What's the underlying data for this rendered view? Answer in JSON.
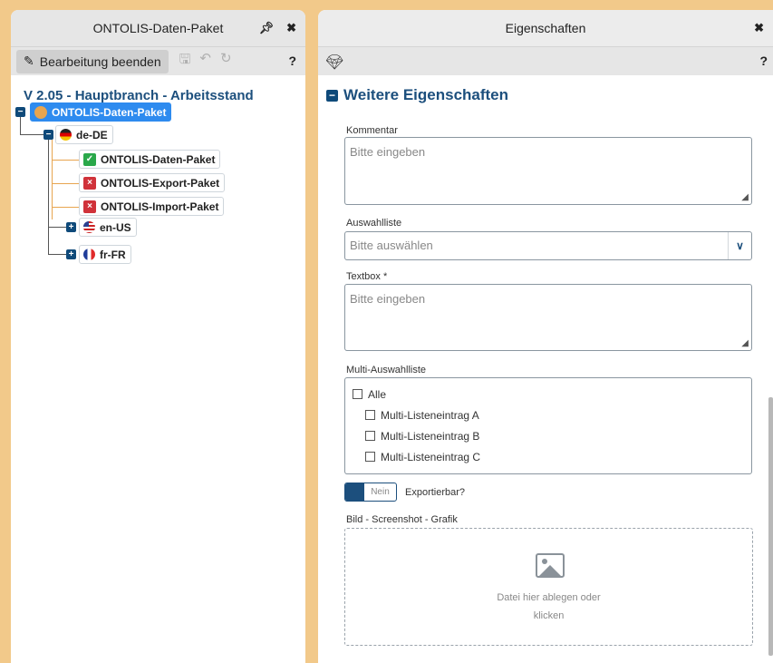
{
  "left_panel": {
    "title": "ONTOLIS-Daten-Paket",
    "pin_icon": "pin-icon",
    "close_icon": "close-icon",
    "edit_button_label": "Bearbeitung beenden",
    "help_label": "?",
    "version_line": "V 2.05 - Hauptbranch - Arbeitsstand",
    "tree": {
      "root": "ONTOLIS-Daten-Paket",
      "lang_de": "de-DE",
      "children": [
        {
          "label": "ONTOLIS-Daten-Paket",
          "status": "ok"
        },
        {
          "label": "ONTOLIS-Export-Paket",
          "status": "error"
        },
        {
          "label": "ONTOLIS-Import-Paket",
          "status": "error"
        }
      ],
      "lang_us": "en-US",
      "lang_fr": "fr-FR"
    }
  },
  "right_panel": {
    "title": "Eigenschaften",
    "help_label": "?",
    "section_title": "Weitere Eigenschaften",
    "fields": {
      "comment_label": "Kommentar",
      "comment_placeholder": "Bitte eingeben",
      "select_label": "Auswahlliste",
      "select_placeholder": "Bitte auswählen",
      "textbox_label": "Textbox *",
      "textbox_placeholder": "Bitte eingeben",
      "multi_label": "Multi-Auswahlliste",
      "multi_all": "Alle",
      "multi_items": [
        "Multi-Listeneintrag A",
        "Multi-Listeneintrag B",
        "Multi-Listeneintrag C"
      ],
      "toggle_value": "Nein",
      "toggle_label": "Exportierbar?",
      "image_label": "Bild - Screenshot - Grafik",
      "drop_line1": "Datei hier ablegen oder",
      "drop_line2": "klicken"
    }
  },
  "colors": {
    "background": "#f2c98a",
    "accent_blue": "#1c4f7d",
    "selected_node": "#2e8bef",
    "tree_connector": "#e8a550"
  }
}
